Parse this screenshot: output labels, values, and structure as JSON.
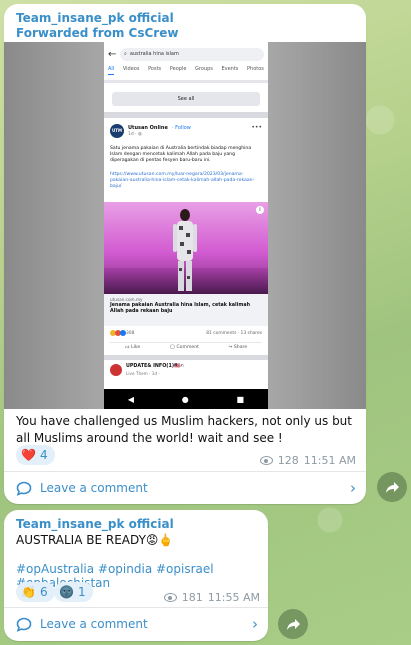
{
  "post1": {
    "channel": "Team_insane_pk official",
    "forwarded": "Forwarded from CsCrew",
    "screenshot": {
      "search_query": "australia hina islam",
      "tabs": [
        "All",
        "Videos",
        "Posts",
        "People",
        "Groups",
        "Events",
        "Photos"
      ],
      "see_all": "See all",
      "page_name": "Utusan Online",
      "page_avatar": "UTM",
      "follow": "· Follow",
      "time": "1d · ",
      "body": "Satu jenama pakaian di Australia bertindak biadap menghina Islam dengan mencetak kalimah Allah pada baju yang diperagakan di pentas fesyen baru-baru ini.",
      "link": "https://www.utusan.com.my/luar-negara/2023/03/jenama-pakaian-australia-hina-islam-cetak-kalimah-allah-pada-rekaan-baju/",
      "domain": "utusan.com.my",
      "headline": "Jenama pakaian Australia hina Islam, cetak kalimah Allah pada rekaan baju",
      "reaction_count": "308",
      "comments_shares": "81 comments · 13 shares",
      "like": "Like",
      "comment": "Comment",
      "share": "Share",
      "next_title": "UPDATE& INFO(1)🇲🇾✍",
      "next_sub": "Live Them · 1d · "
    },
    "message": "You have challenged us Muslim hackers, not only us but all Muslims around the world! wait and see !",
    "reaction_emoji": "❤️",
    "reaction_count": "4",
    "views": "128",
    "time": "11:51 AM",
    "leave_comment": "Leave a comment"
  },
  "post2": {
    "channel": "Team_insane_pk official",
    "message": "AUSTRALIA BE READY😡🖕",
    "hashtags": "#opAustralia #opindia #opisrael #opbalochistan",
    "reactions": [
      {
        "emoji": "👏",
        "count": "6"
      },
      {
        "emoji": "🌚",
        "count": "1"
      }
    ],
    "views": "181",
    "time": "11:55 AM",
    "leave_comment": "Leave a comment"
  },
  "colors": {
    "link_blue": "#3a8fc9",
    "bubble": "#ffffff",
    "meta_gray": "#8e9aa3"
  }
}
